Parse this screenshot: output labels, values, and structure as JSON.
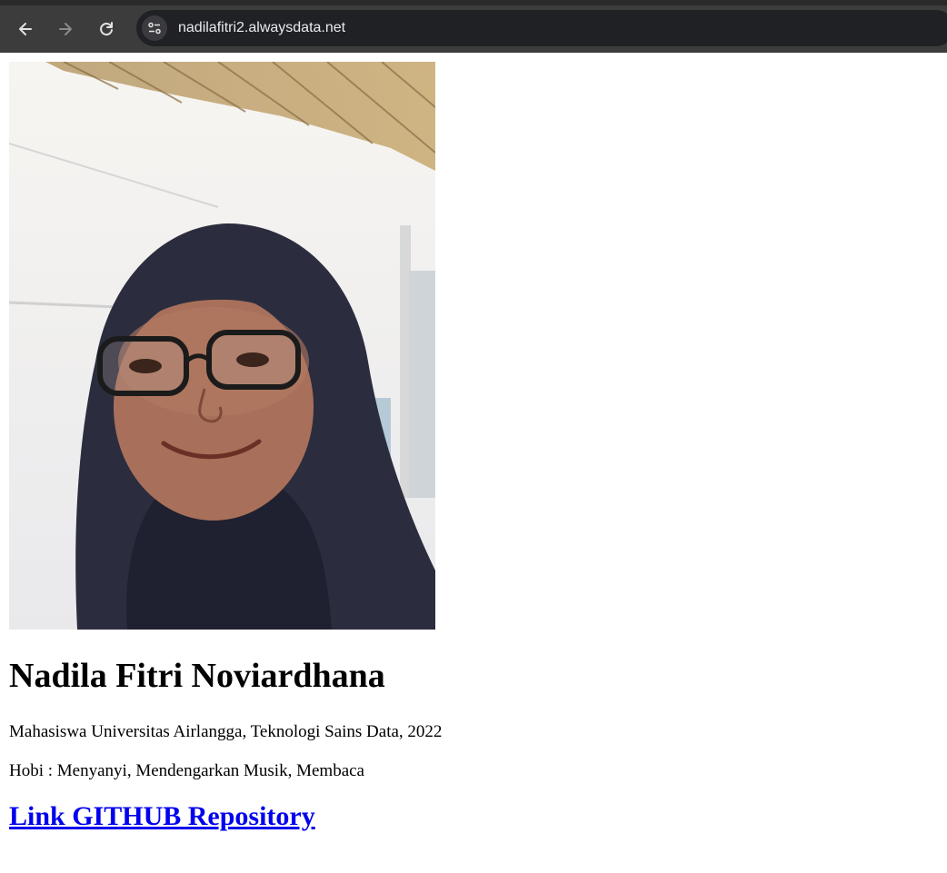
{
  "browser": {
    "url": "nadilafitri2.alwaysdata.net",
    "icons": [
      "back-arrow-icon",
      "forward-arrow-icon",
      "reload-icon",
      "site-info-icon"
    ]
  },
  "profile": {
    "photo_description_icon": "profile-photo",
    "name": "Nadila Fitri Noviardhana",
    "education": "Mahasiswa Universitas Airlangga, Teknologi Sains Data, 2022",
    "hobbies": "Hobi : Menyanyi, Mendengarkan Musik, Membaca",
    "link_text": "Link GITHUB Repository"
  },
  "colors": {
    "link": "#0000ee",
    "chrome": "#3c3c3c",
    "omnibox": "#202124"
  }
}
